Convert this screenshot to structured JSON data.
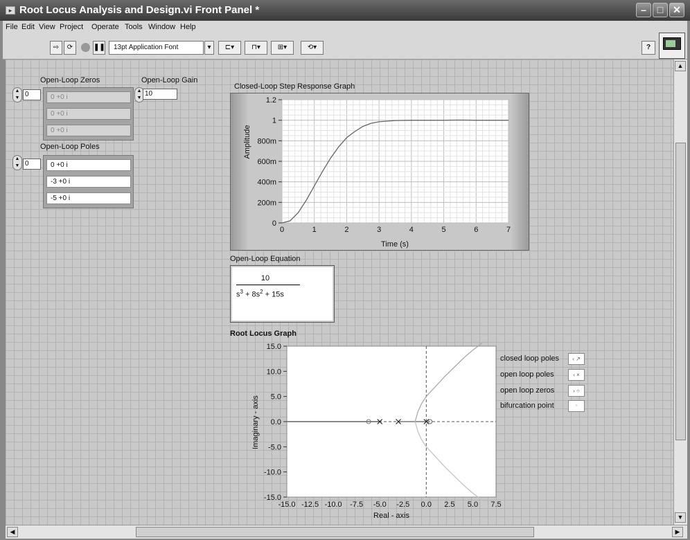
{
  "window": {
    "title": "Root Locus Analysis and Design.vi Front Panel *"
  },
  "menu": [
    "File",
    "Edit",
    "View",
    "Project",
    "Operate",
    "Tools",
    "Window",
    "Help"
  ],
  "toolbar": {
    "font": "13pt Application Font"
  },
  "zeros": {
    "label": "Open-Loop Zeros",
    "index": "0",
    "values": [
      "0 +0 i",
      "0 +0 i",
      "0 +0 i"
    ]
  },
  "poles": {
    "label": "Open-Loop Poles",
    "index": "0",
    "values": [
      "0 +0 i",
      "-3 +0 i",
      "-5 +0 i"
    ]
  },
  "gain": {
    "label": "Open-Loop Gain",
    "value": "10"
  },
  "step_graph": {
    "label": "Closed-Loop Step Response Graph",
    "ylabel": "Amplitude",
    "xlabel": "Time (s)",
    "yticks": [
      "1.2",
      "1",
      "800m",
      "600m",
      "400m",
      "200m",
      "0"
    ],
    "xticks": [
      "0",
      "1",
      "2",
      "3",
      "4",
      "5",
      "6",
      "7"
    ]
  },
  "equation": {
    "label": "Open-Loop Equation",
    "numerator": "10",
    "den_1": "s",
    "exp_1": "3",
    "den_2": " + 8s",
    "exp_2": "2",
    "den_3": " + 15s"
  },
  "root_locus": {
    "label": "Root Locus Graph",
    "ylabel": "Imaginary - axis",
    "xlabel": "Real - axis",
    "yticks": [
      "15.0",
      "10.0",
      "5.0",
      "0.0",
      "-5.0",
      "-10.0",
      "-15.0"
    ],
    "xticks": [
      "-15.0",
      "-12.5",
      "-10.0",
      "-7.5",
      "-5.0",
      "-2.5",
      "0.0",
      "2.5",
      "5.0",
      "7.5"
    ],
    "legend": [
      "closed loop poles",
      "open loop poles",
      "open loop zeros",
      "bifurcation point"
    ]
  },
  "chart_data": [
    {
      "type": "line",
      "title": "Closed-Loop Step Response Graph",
      "xlabel": "Time (s)",
      "ylabel": "Amplitude",
      "xlim": [
        0,
        7
      ],
      "ylim": [
        0,
        1.2
      ],
      "grid": true,
      "x": [
        0,
        0.25,
        0.5,
        0.75,
        1,
        1.25,
        1.5,
        1.75,
        2,
        2.25,
        2.5,
        2.75,
        3,
        3.5,
        4,
        4.5,
        5,
        5.5,
        6,
        7
      ],
      "y": [
        0,
        0.02,
        0.1,
        0.22,
        0.36,
        0.5,
        0.63,
        0.74,
        0.83,
        0.89,
        0.94,
        0.97,
        0.985,
        0.997,
        1.0,
        1.0,
        1.0,
        1.002,
        1.0,
        1.0
      ]
    },
    {
      "type": "scatter",
      "title": "Root Locus Graph",
      "xlabel": "Real - axis",
      "ylabel": "Imaginary - axis",
      "xlim": [
        -15,
        7.5
      ],
      "ylim": [
        -15,
        15
      ],
      "series": [
        {
          "name": "open loop poles",
          "x": [
            0,
            -3,
            -5
          ],
          "y": [
            0,
            0,
            0
          ]
        },
        {
          "name": "closed loop poles",
          "x": [
            -6.2,
            0.4,
            0.4
          ],
          "y": [
            0,
            0,
            0
          ]
        }
      ],
      "locus_upper": {
        "x": [
          -1.2,
          -0.9,
          -0.5,
          0,
          1,
          2,
          3,
          4,
          5,
          6
        ],
        "y": [
          0,
          2,
          3.6,
          5,
          7,
          9,
          10.8,
          12.6,
          14.2,
          15.6
        ]
      },
      "locus_real": {
        "x": [
          -15,
          -5
        ],
        "y": [
          0,
          0
        ]
      }
    }
  ]
}
